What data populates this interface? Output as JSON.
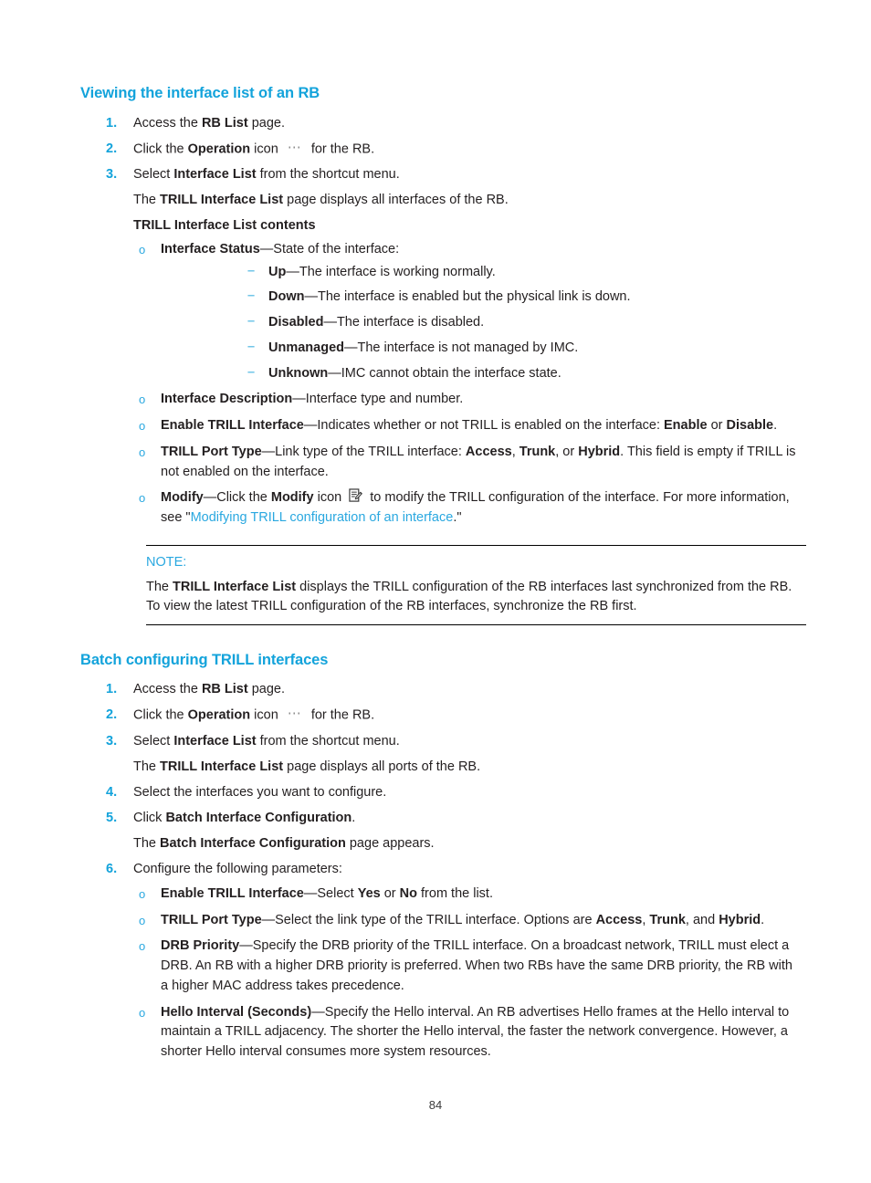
{
  "document": {
    "page_number": "84",
    "accent_color": "#13a3db",
    "link_color": "#2aa8e0",
    "text_color": "#231f20"
  },
  "section1": {
    "heading": "Viewing the interface list of an RB",
    "steps": [
      {
        "num": "1.",
        "pre": "Access the ",
        "bold": "RB List",
        "post": " page."
      },
      {
        "num": "2.",
        "pre": "Click the ",
        "bold": "Operation",
        "mid": " icon ",
        "icon": "ellipsis-icon",
        "post": " for the RB."
      },
      {
        "num": "3.",
        "pre": "Select ",
        "bold": "Interface List",
        "post": " from the shortcut menu."
      }
    ],
    "result_line": {
      "pre": "The ",
      "bold": "TRILL Interface List",
      "post": " page displays all interfaces of the RB."
    },
    "contents_heading": "TRILL Interface List contents",
    "items": [
      {
        "term": "Interface Status",
        "dash": "—",
        "desc": "State of the interface:",
        "subitems": [
          {
            "term": "Up",
            "dash": "—",
            "desc": "The interface is working normally."
          },
          {
            "term": "Down",
            "dash": "—",
            "desc": "The interface is enabled but the physical link is down."
          },
          {
            "term": "Disabled",
            "dash": "—",
            "desc": "The interface is disabled."
          },
          {
            "term": "Unmanaged",
            "dash": "—",
            "desc": "The interface is not managed by IMC."
          },
          {
            "term": "Unknown",
            "dash": "—",
            "desc": "IMC cannot obtain the interface state."
          }
        ]
      },
      {
        "term": "Interface Description",
        "dash": "—",
        "desc": "Interface type and number."
      },
      {
        "term": "Enable TRILL Interface",
        "dash": "—",
        "desc_parts": [
          {
            "t": "Indicates whether or not TRILL is enabled on the interface: ",
            "b": false
          },
          {
            "t": "Enable",
            "b": true
          },
          {
            "t": " or ",
            "b": false
          },
          {
            "t": "Disable",
            "b": true
          },
          {
            "t": ".",
            "b": false
          }
        ]
      },
      {
        "term": "TRILL Port Type",
        "dash": "—",
        "desc_parts": [
          {
            "t": "Link type of the TRILL interface: ",
            "b": false
          },
          {
            "t": "Access",
            "b": true
          },
          {
            "t": ", ",
            "b": false
          },
          {
            "t": "Trunk",
            "b": true
          },
          {
            "t": ", or ",
            "b": false
          },
          {
            "t": "Hybrid",
            "b": true
          },
          {
            "t": ". This field is empty if TRILL is not enabled on the interface.",
            "b": false
          }
        ]
      },
      {
        "term": "Modify",
        "dash": "—",
        "modify_pre": "Click the ",
        "modify_bold": "Modify",
        "modify_mid": " icon ",
        "modify_icon": "modify-document-pencil-icon",
        "modify_post": " to modify the TRILL configuration of the interface. For more information, see \"",
        "modify_link": "Modifying TRILL configuration of an interface",
        "modify_end": ".\""
      }
    ],
    "note": {
      "label": "NOTE:",
      "pre": "The ",
      "bold": "TRILL Interface List",
      "post": " displays the TRILL configuration of the RB interfaces last synchronized from the RB. To view the latest TRILL configuration of the RB interfaces, synchronize the RB first."
    }
  },
  "section2": {
    "heading": "Batch configuring TRILL interfaces",
    "steps": [
      {
        "num": "1.",
        "pre": "Access the ",
        "bold": "RB List",
        "post": " page."
      },
      {
        "num": "2.",
        "pre": "Click the ",
        "bold": "Operation",
        "mid": " icon ",
        "icon": "ellipsis-icon",
        "post": " for the RB."
      },
      {
        "num": "3.",
        "pre": "Select ",
        "bold": "Interface List",
        "post": " from the shortcut menu."
      }
    ],
    "result_line_3": {
      "pre": "The ",
      "bold": "TRILL Interface List",
      "post": " page displays all ports of the RB."
    },
    "step4": {
      "num": "4.",
      "pre": "Select the interfaces you want to configure.",
      "bold": "",
      "post": ""
    },
    "step5": {
      "num": "5.",
      "pre": "Click ",
      "bold": "Batch Interface Configuration",
      "post": "."
    },
    "result_line_5": {
      "pre": "The ",
      "bold": "Batch Interface Configuration",
      "post": " page appears."
    },
    "step6": {
      "num": "6.",
      "pre": "Configure the following parameters:",
      "bold": "",
      "post": ""
    },
    "items": [
      {
        "term": "Enable TRILL Interface",
        "dash": "—",
        "desc_parts": [
          {
            "t": "Select ",
            "b": false
          },
          {
            "t": "Yes",
            "b": true
          },
          {
            "t": " or ",
            "b": false
          },
          {
            "t": "No",
            "b": true
          },
          {
            "t": " from the list.",
            "b": false
          }
        ]
      },
      {
        "term": "TRILL Port Type",
        "dash": "—",
        "desc_parts": [
          {
            "t": "Select the link type of the TRILL interface. Options are ",
            "b": false
          },
          {
            "t": "Access",
            "b": true
          },
          {
            "t": ", ",
            "b": false
          },
          {
            "t": "Trunk",
            "b": true
          },
          {
            "t": ", and ",
            "b": false
          },
          {
            "t": "Hybrid",
            "b": true
          },
          {
            "t": ".",
            "b": false
          }
        ]
      },
      {
        "term": "DRB Priority",
        "dash": "—",
        "desc": "Specify the DRB priority of the TRILL interface. On a broadcast network, TRILL must elect a DRB. An RB with a higher DRB priority is preferred. When two RBs have the same DRB priority, the RB with a higher MAC address takes precedence."
      },
      {
        "term": "Hello Interval (Seconds)",
        "dash": "—",
        "desc": "Specify the Hello interval. An RB advertises Hello frames at the Hello interval to maintain a TRILL adjacency. The shorter the Hello interval, the faster the network convergence. However, a shorter Hello interval consumes more system resources."
      }
    ]
  }
}
